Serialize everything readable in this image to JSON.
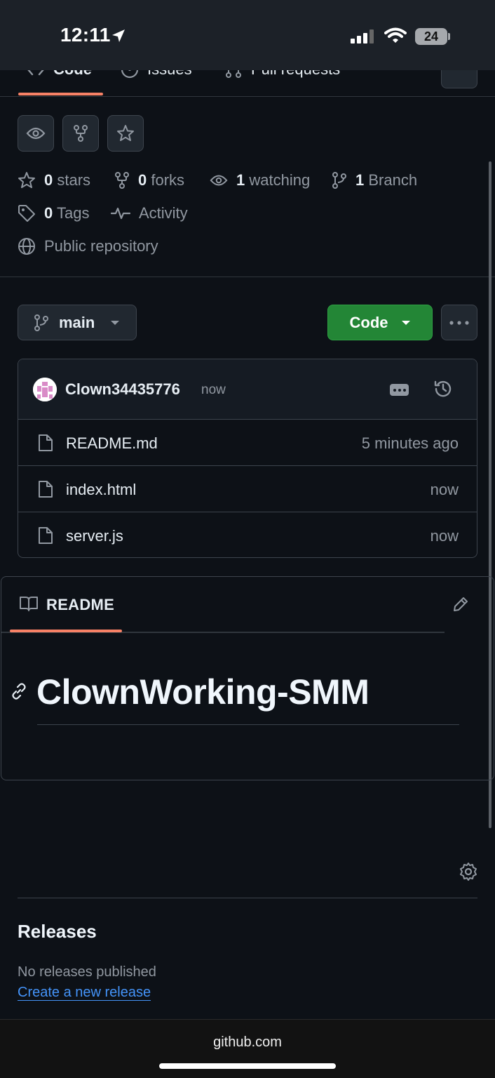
{
  "status_bar": {
    "time": "12:11",
    "battery": "24"
  },
  "repo_nav": {
    "tabs": [
      "Code",
      "Issues",
      "Pull requests"
    ]
  },
  "stats": {
    "stars_count": "0",
    "stars_label": "stars",
    "forks_count": "0",
    "forks_label": "forks",
    "watching_count": "1",
    "watching_label": "watching",
    "branch_count": "1",
    "branch_label": "Branch",
    "tags_count": "0",
    "tags_label": "Tags",
    "activity_label": "Activity",
    "visibility_label": "Public repository"
  },
  "branch": {
    "name": "main"
  },
  "code_button": {
    "label": "Code"
  },
  "latest_commit": {
    "author": "Clown34435776",
    "time": "now"
  },
  "files": [
    {
      "name": "README.md",
      "time": "5 minutes ago"
    },
    {
      "name": "index.html",
      "time": "now"
    },
    {
      "name": "server.js",
      "time": "now"
    }
  ],
  "readme": {
    "tab_label": "README",
    "heading": "ClownWorking-SMM"
  },
  "releases": {
    "title": "Releases",
    "empty_text": "No releases published",
    "create_link": "Create a new release"
  },
  "browser": {
    "url": "github.com"
  },
  "colors": {
    "accent_green": "#238636",
    "tab_underline": "#f78166",
    "link_blue": "#4493f8",
    "background": "#0d1117"
  }
}
